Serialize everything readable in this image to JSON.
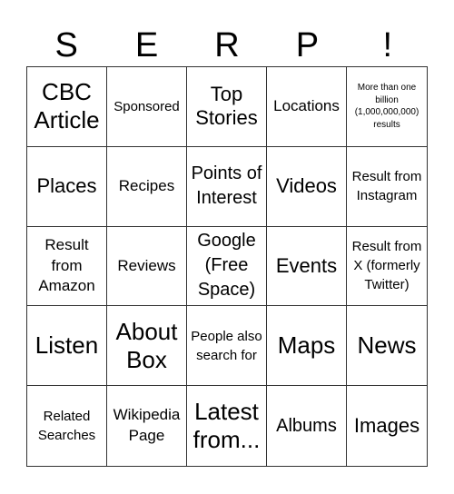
{
  "header": [
    "S",
    "E",
    "R",
    "P",
    "!"
  ],
  "cells": [
    "CBC Article",
    "Sponsored",
    "Top Stories",
    "Locations",
    "More than one billion (1,000,000,000) results",
    "Places",
    "Recipes",
    "Points of Interest",
    "Videos",
    "Result from Instagram",
    "Result from Amazon",
    "Reviews",
    "Google (Free Space)",
    "Events",
    "Result from X (formerly Twitter)",
    "Listen",
    "About Box",
    "People also search for",
    "Maps",
    "News",
    "Related Searches",
    "Wikipedia Page",
    "Latest from...",
    "Albums",
    "Images"
  ]
}
